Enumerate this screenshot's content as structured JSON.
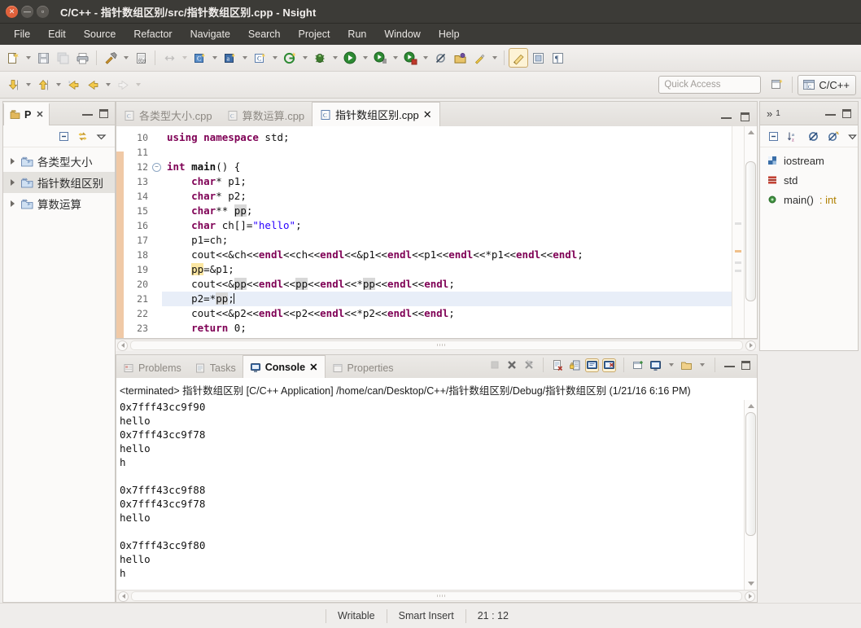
{
  "window": {
    "title": "C/C++ - 指针数组区别/src/指针数组区别.cpp - Nsight",
    "buttons": {
      "close": "×",
      "minimize": "–",
      "maximize": "▫"
    }
  },
  "menubar": {
    "items": [
      {
        "label": "File",
        "name": "menu-file"
      },
      {
        "label": "Edit",
        "name": "menu-edit"
      },
      {
        "label": "Source",
        "name": "menu-source"
      },
      {
        "label": "Refactor",
        "name": "menu-refactor"
      },
      {
        "label": "Navigate",
        "name": "menu-navigate"
      },
      {
        "label": "Search",
        "name": "menu-search"
      },
      {
        "label": "Project",
        "name": "menu-project"
      },
      {
        "label": "Run",
        "name": "menu-run"
      },
      {
        "label": "Window",
        "name": "menu-window"
      },
      {
        "label": "Help",
        "name": "menu-help"
      }
    ]
  },
  "toolbar": {
    "quick_access_placeholder": "Quick Access",
    "perspective_label": "C/C++",
    "icons": [
      "new-file-icon",
      "save-icon",
      "save-all-icon",
      "print-icon",
      "build-hammer-icon",
      "binary-file-icon",
      "link-editors-icon",
      "new-c-class-icon",
      "new-c-source-icon",
      "new-c-project-icon",
      "run-target-icon",
      "debug-bug-icon",
      "run-icon",
      "run-configurations-icon",
      "stop-marker-icon",
      "skip-breakpoints-icon",
      "open-type-icon",
      "search-icon",
      "toggle-mark-occurrences-icon",
      "toggle-block-selection-icon",
      "show-whitespace-icon"
    ],
    "row2_icons": [
      "next-annotation-icon",
      "previous-annotation-icon",
      "last-edit-location-icon",
      "back-icon",
      "forward-icon"
    ]
  },
  "project_explorer": {
    "title": "P",
    "close_label": "✕",
    "toolbar_icons": [
      "collapse-all-icon",
      "link-with-editor-icon",
      "view-menu-icon"
    ],
    "items": [
      {
        "label": "各类型大小",
        "selected": false
      },
      {
        "label": "指针数组区别",
        "selected": true
      },
      {
        "label": "算数运算",
        "selected": false
      }
    ]
  },
  "editor": {
    "tabs": [
      {
        "label": "各类型大小.cpp",
        "active": false,
        "closable": false
      },
      {
        "label": "算数运算.cpp",
        "active": false,
        "closable": false
      },
      {
        "label": "指针数组区别.cpp",
        "active": true,
        "closable": true,
        "close_label": "✕"
      }
    ],
    "first_line_number": 10,
    "lines": [
      {
        "num": "10",
        "fold": false,
        "current": false,
        "tokens": [
          {
            "t": "using ",
            "c": "kw"
          },
          {
            "t": "namespace ",
            "c": "kw"
          },
          {
            "t": "std;",
            "c": ""
          }
        ]
      },
      {
        "num": "11",
        "fold": false,
        "current": false,
        "tokens": []
      },
      {
        "num": "12",
        "fold": true,
        "current": false,
        "tokens": [
          {
            "t": "int ",
            "c": "kw"
          },
          {
            "t": "main",
            "c": "b"
          },
          {
            "t": "() {",
            "c": ""
          }
        ]
      },
      {
        "num": "13",
        "fold": false,
        "current": false,
        "tokens": [
          {
            "t": "    ",
            "c": ""
          },
          {
            "t": "char",
            "c": "kw"
          },
          {
            "t": "* p1;",
            "c": ""
          }
        ]
      },
      {
        "num": "14",
        "fold": false,
        "current": false,
        "tokens": [
          {
            "t": "    ",
            "c": ""
          },
          {
            "t": "char",
            "c": "kw"
          },
          {
            "t": "* p2;",
            "c": ""
          }
        ]
      },
      {
        "num": "15",
        "fold": false,
        "current": false,
        "tokens": [
          {
            "t": "    ",
            "c": ""
          },
          {
            "t": "char",
            "c": "kw"
          },
          {
            "t": "** ",
            "c": ""
          },
          {
            "t": "pp",
            "c": "occ"
          },
          {
            "t": ";",
            "c": ""
          }
        ]
      },
      {
        "num": "16",
        "fold": false,
        "current": false,
        "tokens": [
          {
            "t": "    ",
            "c": ""
          },
          {
            "t": "char",
            "c": "kw"
          },
          {
            "t": " ch[]=",
            "c": ""
          },
          {
            "t": "\"hello\"",
            "c": "str"
          },
          {
            "t": ";",
            "c": ""
          }
        ]
      },
      {
        "num": "17",
        "fold": false,
        "current": false,
        "tokens": [
          {
            "t": "    p1=ch;",
            "c": ""
          }
        ]
      },
      {
        "num": "18",
        "fold": false,
        "current": false,
        "tokens": [
          {
            "t": "    cout<<&ch<<",
            "c": ""
          },
          {
            "t": "endl",
            "c": "kw"
          },
          {
            "t": "<<ch<<",
            "c": ""
          },
          {
            "t": "endl",
            "c": "kw"
          },
          {
            "t": "<<&p1<<",
            "c": ""
          },
          {
            "t": "endl",
            "c": "kw"
          },
          {
            "t": "<<p1<<",
            "c": ""
          },
          {
            "t": "endl",
            "c": "kw"
          },
          {
            "t": "<<*p1<<",
            "c": ""
          },
          {
            "t": "endl",
            "c": "kw"
          },
          {
            "t": "<<",
            "c": ""
          },
          {
            "t": "endl",
            "c": "kw"
          },
          {
            "t": ";",
            "c": ""
          }
        ]
      },
      {
        "num": "19",
        "fold": false,
        "current": false,
        "tokens": [
          {
            "t": "    ",
            "c": ""
          },
          {
            "t": "pp",
            "c": "occy"
          },
          {
            "t": "=&p1;",
            "c": ""
          }
        ]
      },
      {
        "num": "20",
        "fold": false,
        "current": false,
        "tokens": [
          {
            "t": "    cout<<&",
            "c": ""
          },
          {
            "t": "pp",
            "c": "occ"
          },
          {
            "t": "<<",
            "c": ""
          },
          {
            "t": "endl",
            "c": "kw"
          },
          {
            "t": "<<",
            "c": ""
          },
          {
            "t": "pp",
            "c": "occ"
          },
          {
            "t": "<<",
            "c": ""
          },
          {
            "t": "endl",
            "c": "kw"
          },
          {
            "t": "<<*",
            "c": ""
          },
          {
            "t": "pp",
            "c": "occ"
          },
          {
            "t": "<<",
            "c": ""
          },
          {
            "t": "endl",
            "c": "kw"
          },
          {
            "t": "<<",
            "c": ""
          },
          {
            "t": "endl",
            "c": "kw"
          },
          {
            "t": ";",
            "c": ""
          }
        ]
      },
      {
        "num": "21",
        "fold": false,
        "current": true,
        "tokens": [
          {
            "t": "    p2=*",
            "c": ""
          },
          {
            "t": "pp",
            "c": "occ"
          },
          {
            "t": ";",
            "c": ""
          },
          {
            "t": "|",
            "c": "caret"
          }
        ]
      },
      {
        "num": "22",
        "fold": false,
        "current": false,
        "tokens": [
          {
            "t": "    cout<<&p2<<",
            "c": ""
          },
          {
            "t": "endl",
            "c": "kw"
          },
          {
            "t": "<<p2<<",
            "c": ""
          },
          {
            "t": "endl",
            "c": "kw"
          },
          {
            "t": "<<*p2<<",
            "c": ""
          },
          {
            "t": "endl",
            "c": "kw"
          },
          {
            "t": "<<",
            "c": ""
          },
          {
            "t": "endl",
            "c": "kw"
          },
          {
            "t": ";",
            "c": ""
          }
        ]
      },
      {
        "num": "23",
        "fold": false,
        "current": false,
        "tokens": [
          {
            "t": "    ",
            "c": ""
          },
          {
            "t": "return ",
            "c": "kw"
          },
          {
            "t": "0;",
            "c": ""
          }
        ]
      }
    ]
  },
  "outline": {
    "overflow_label": "»",
    "overflow_count": "1",
    "toolbar_icons": [
      "collapse-all-icon",
      "sort-az-icon",
      "hide-fields-icon",
      "hide-static-icon",
      "view-menu-icon"
    ],
    "items": [
      {
        "label": "iostream",
        "type": "",
        "icon": "include-icon"
      },
      {
        "label": "std",
        "type": "",
        "icon": "namespace-icon"
      },
      {
        "label": "main()",
        "type": " : int",
        "icon": "function-icon"
      }
    ]
  },
  "console": {
    "tabs": [
      {
        "label": "Problems",
        "active": false,
        "icon": "problems-icon"
      },
      {
        "label": "Tasks",
        "active": false,
        "icon": "tasks-icon"
      },
      {
        "label": "Console",
        "active": true,
        "icon": "console-icon",
        "close_label": "✕"
      },
      {
        "label": "Properties",
        "active": false,
        "icon": "properties-icon"
      }
    ],
    "toolbar_icons": [
      "terminate-icon",
      "remove-launch-icon",
      "remove-all-terminated-icon",
      "clear-console-icon",
      "scroll-lock-icon",
      "show-console-on-output-icon",
      "show-console-on-error-icon",
      "pin-console-icon",
      "display-selected-console-icon",
      "open-console-icon"
    ],
    "header": "<terminated> 指针数组区别 [C/C++ Application] /home/can/Desktop/C++/指针数组区别/Debug/指针数组区别 (1/21/16 6:16 PM)",
    "output": [
      "0x7fff43cc9f90",
      "hello",
      "0x7fff43cc9f78",
      "hello",
      "h",
      "",
      "0x7fff43cc9f88",
      "0x7fff43cc9f78",
      "hello",
      "",
      "0x7fff43cc9f80",
      "hello",
      "h"
    ]
  },
  "statusbar": {
    "writable": "Writable",
    "insert_mode": "Smart Insert",
    "position": "21 : 12"
  },
  "colors": {
    "titlebar_bg": "#3c3b37",
    "close_button": "#e0613b",
    "keyword": "#7f0055",
    "string": "#2a00ff",
    "selection": "#e8eef8",
    "occurrence": "#d8d8d8",
    "write_occurrence": "#fbe6a2",
    "annotation_ruler": "#f0c9a6"
  }
}
